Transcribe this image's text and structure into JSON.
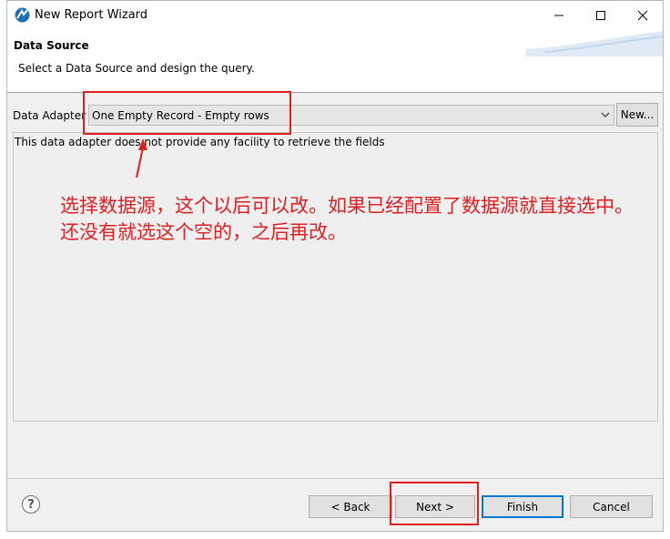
{
  "window": {
    "title": "New Report Wizard",
    "controls": {
      "minimize_icon": "minimize-icon",
      "maximize_icon": "maximize-icon",
      "close_icon": "close-icon"
    }
  },
  "header": {
    "title": "Data Source",
    "description": "Select a Data Source and design the query."
  },
  "data_adapter": {
    "label": "Data Adapter",
    "selected": "One Empty Record - Empty rows",
    "new_button": "New..."
  },
  "info": {
    "text": "This data adapter does not provide any facility to retrieve the fields"
  },
  "annotation": {
    "note": "选择数据源，这个以后可以改。如果已经配置了数据源就直接选中。还没有就选这个空的，之后再改。",
    "color": "#e02020"
  },
  "footer": {
    "help_label": "?",
    "back": "< Back",
    "next": "Next >",
    "finish": "Finish",
    "cancel": "Cancel"
  },
  "colors": {
    "default_button_border": "#0078d7",
    "annotation_red": "#e01e1e"
  }
}
